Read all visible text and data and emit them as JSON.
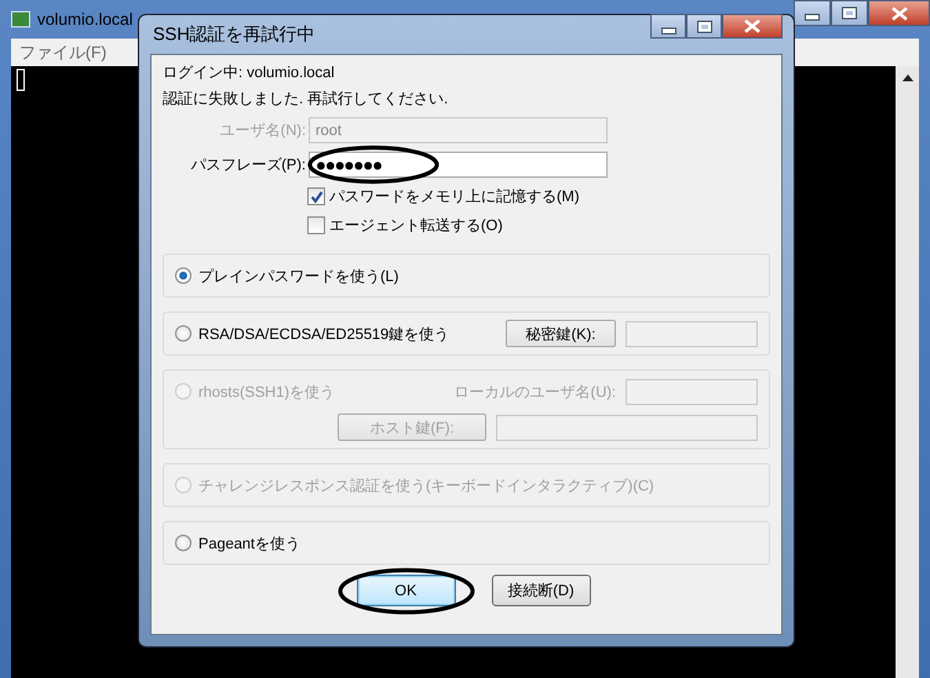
{
  "background_window": {
    "title": "volumio.local",
    "menu": [
      "ファイル(F)"
    ]
  },
  "dialog": {
    "title": "SSH認証を再試行中",
    "login_text": "ログイン中: volumio.local",
    "message": "認証に失敗しました. 再試行してください.",
    "fields": [
      {
        "label": "ユーザ名(N):",
        "value": "root",
        "disabled": true,
        "circled": false
      },
      {
        "label": "パスフレーズ(P):",
        "value": "●●●●●●●",
        "disabled": false,
        "circled": true
      }
    ],
    "checkboxes": [
      {
        "label": "パスワードをメモリ上に記憶する(M)",
        "checked": true
      },
      {
        "label": "エージェント転送する(O)",
        "checked": false
      }
    ],
    "methods": [
      {
        "label": "プレインパスワードを使う(L)",
        "selected": true,
        "disabled": false
      },
      {
        "label": "RSA/DSA/ECDSA/ED25519鍵を使う",
        "selected": false,
        "disabled": false,
        "lines": [
          [
            {
              "kind": "button",
              "text": "秘密鍵(K):"
            },
            {
              "kind": "field"
            }
          ]
        ]
      },
      {
        "label": "rhosts(SSH1)を使う",
        "selected": false,
        "disabled": true,
        "lines": [
          [
            {
              "kind": "label",
              "text": "ローカルのユーザ名(U):"
            },
            {
              "kind": "field"
            }
          ],
          [
            {
              "kind": "button",
              "text": "ホスト鍵(F):"
            },
            {
              "kind": "field"
            }
          ]
        ]
      },
      {
        "label": "チャレンジレスポンス認証を使う(キーボードインタラクティブ)(C)",
        "selected": false,
        "disabled": true
      },
      {
        "label": "Pageantを使う",
        "selected": false,
        "disabled": false
      }
    ],
    "buttons": [
      {
        "label": "OK",
        "default": true,
        "circled": true
      },
      {
        "label": "接続断(D)",
        "default": false,
        "circled": false
      }
    ]
  }
}
